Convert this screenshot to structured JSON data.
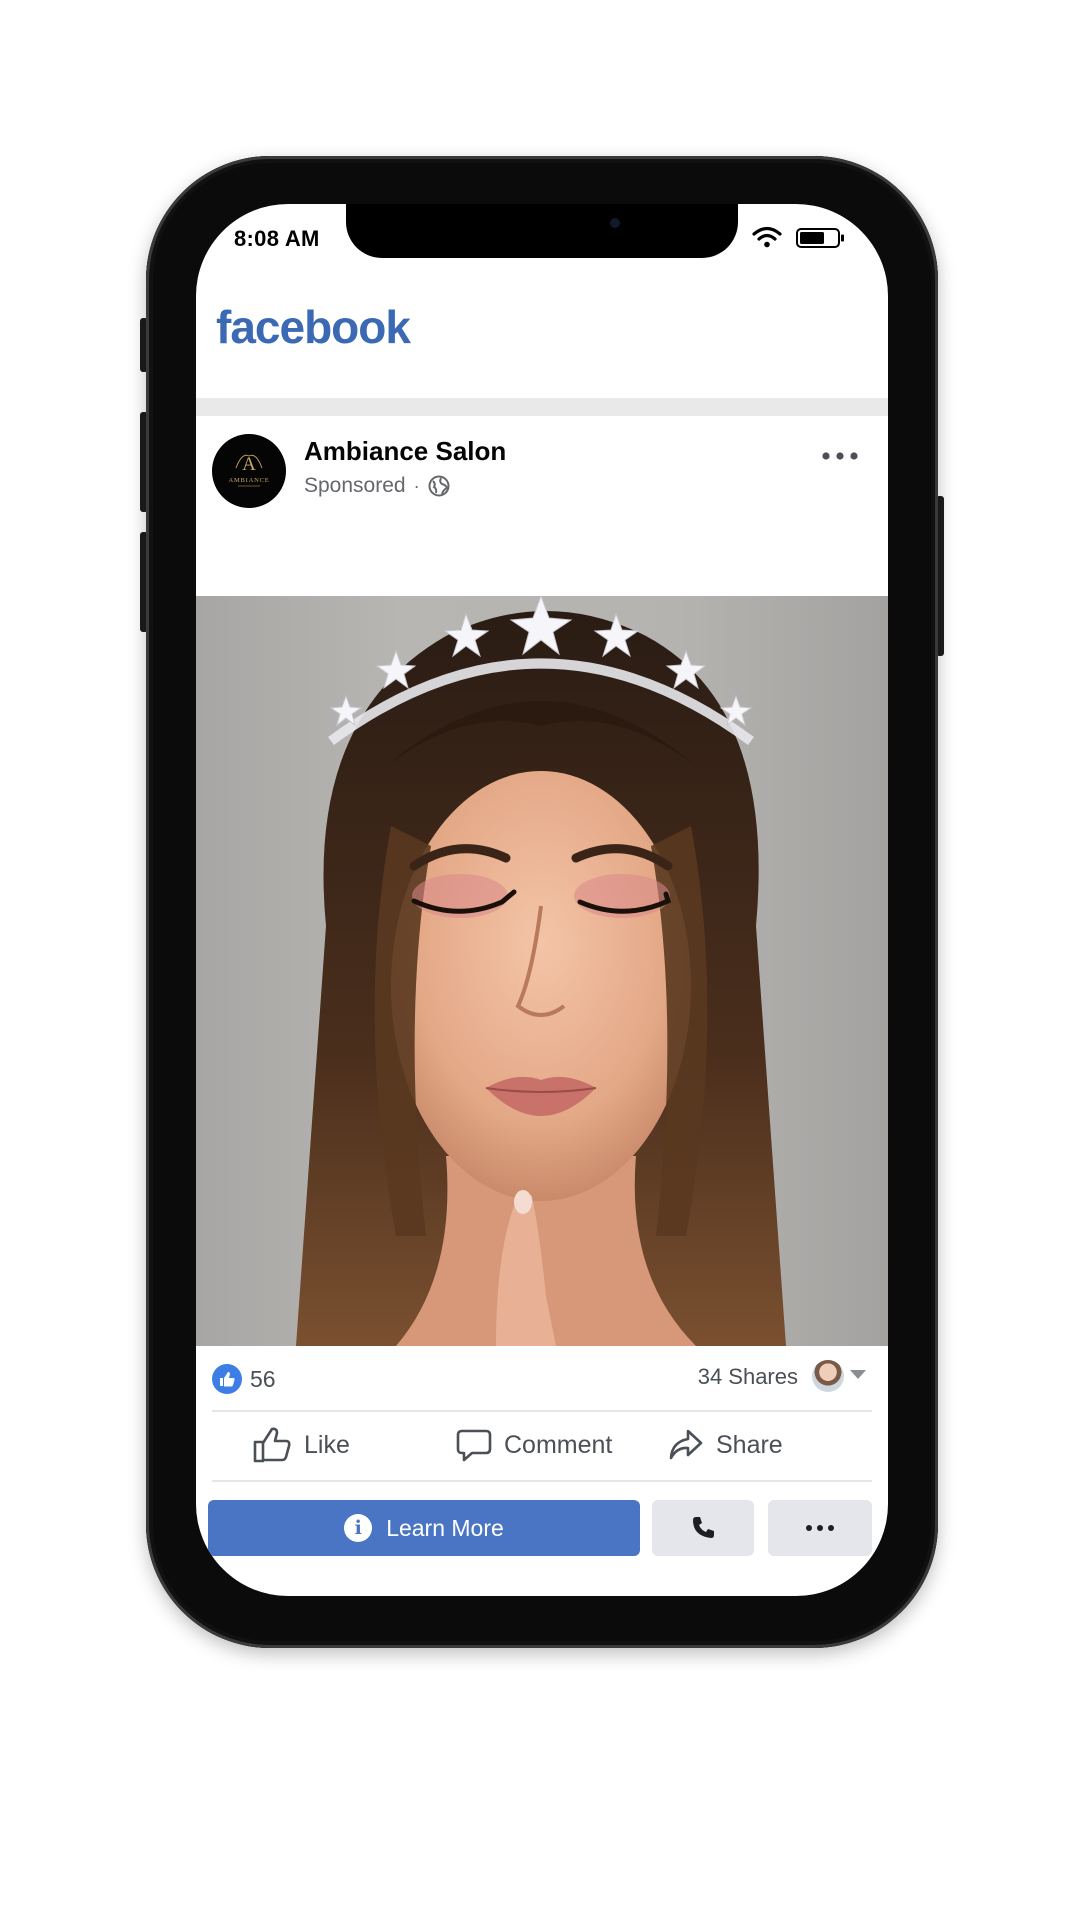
{
  "status_bar": {
    "time": "8:08 AM"
  },
  "app": {
    "logo_text": "facebook",
    "brand_color": "#3b69b4"
  },
  "post": {
    "page_name": "Ambiance Salon",
    "avatar_logo_letter": "A",
    "avatar_logo_text": "AMBIANCE",
    "sponsored_label": "Sponsored",
    "separator": "·",
    "privacy_icon": "globe-icon",
    "image_subject": "bride-portrait-with-tiara"
  },
  "engagement": {
    "reaction_icon": "thumbs-up-icon",
    "reaction_count": "56",
    "shares_label": "34 Shares"
  },
  "actions": {
    "like_label": "Like",
    "comment_label": "Comment",
    "share_label": "Share"
  },
  "cta": {
    "learn_more_label": "Learn More",
    "learn_more_color": "#4a75c4",
    "call_icon": "phone-icon",
    "more_icon": "more-horizontal-icon"
  }
}
